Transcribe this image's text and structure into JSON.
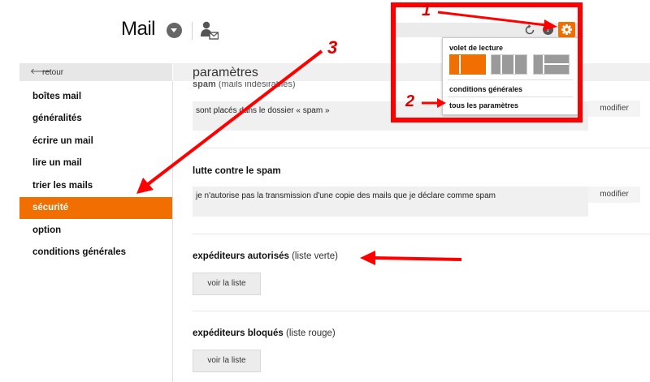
{
  "header": {
    "app_title": "Mail",
    "icons": [
      "chevron-down-icon",
      "contact-card-icon",
      "refresh-icon",
      "help-icon",
      "gear-icon"
    ],
    "help_symbol": "?"
  },
  "sidebar": {
    "back_label": "retour",
    "back_arrow": "🡐",
    "items": [
      {
        "label": "boîtes mail",
        "active": false
      },
      {
        "label": "généralités",
        "active": false
      },
      {
        "label": "écrire un mail",
        "active": false
      },
      {
        "label": "lire un mail",
        "active": false
      },
      {
        "label": "trier les mails",
        "active": false
      },
      {
        "label": "sécurité",
        "active": true
      },
      {
        "label": "option",
        "active": false
      },
      {
        "label": "conditions générales",
        "active": false
      }
    ]
  },
  "main": {
    "title": "paramètres",
    "spam_section": {
      "heading": "spam",
      "heading_sub": "(mails indésirables)",
      "value": "sont placés dans le dossier « spam »",
      "modify_label": "modifier"
    },
    "anti_spam_section": {
      "title": "lutte contre le spam",
      "value": "je n'autorise pas la transmission d'une copie des mails que je déclare comme spam",
      "modify_label": "modifier"
    },
    "allowed_senders": {
      "title": "expéditeurs autorisés",
      "subtitle": "(liste verte)",
      "button_label": "voir la liste"
    },
    "blocked_senders": {
      "title": "expéditeurs bloqués",
      "subtitle": "(liste rouge)",
      "button_label": "voir la liste"
    }
  },
  "settings_popup": {
    "heading": "volet de lecture",
    "layout_options": [
      {
        "name": "reading-pane-right",
        "selected": true
      },
      {
        "name": "reading-pane-columns",
        "selected": false
      },
      {
        "name": "reading-pane-bottom",
        "selected": false
      }
    ],
    "links": [
      "conditions générales",
      "tous les paramètres"
    ]
  },
  "annotations": {
    "markers": [
      "1",
      "2",
      "3"
    ],
    "color": "#e00000"
  },
  "colors": {
    "accent": "#f16e00",
    "annotation_red": "#ff0000"
  }
}
